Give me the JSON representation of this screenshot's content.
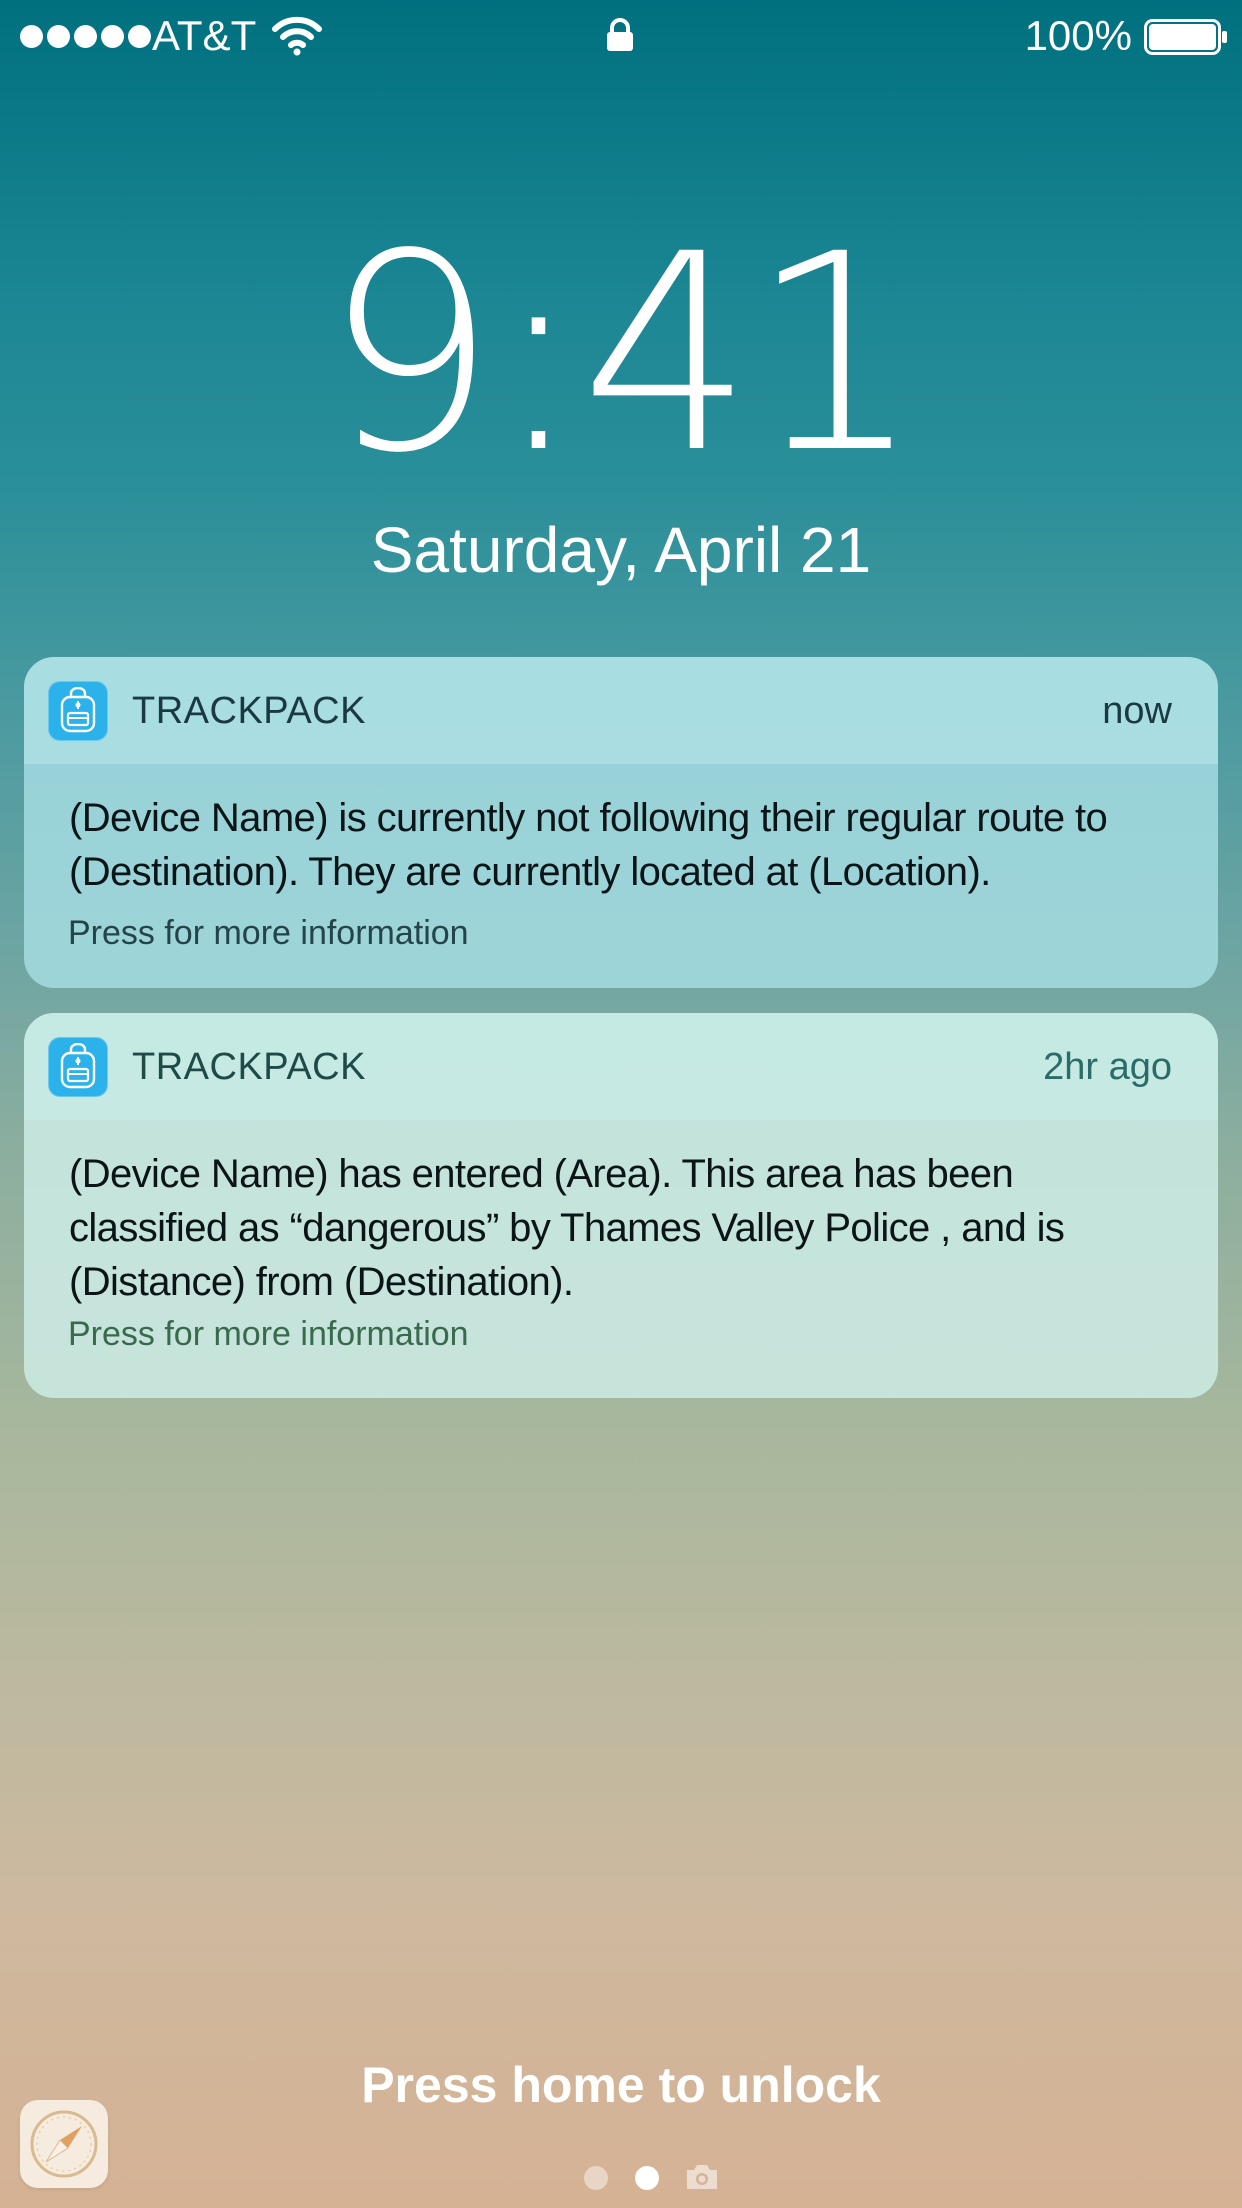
{
  "status_bar": {
    "carrier": "AT&T",
    "battery_percent": "100%",
    "signal_bars": 5,
    "battery_level": 1.0,
    "wifi_icon": "wifi-icon",
    "lock_icon": "lock-icon"
  },
  "lock_screen": {
    "time": "9:41",
    "date": "Saturday, April 21",
    "unlock_hint": "Press home to unlock"
  },
  "notifications": [
    {
      "app_name": "TRACKPACK",
      "time": "now",
      "body": "(Device Name) is currently not following their regular route to (Destination). They are currently located at (Location).",
      "more": "Press for more information",
      "icon": "backpack-icon"
    },
    {
      "app_name": "TRACKPACK",
      "time": "2hr ago",
      "body": "(Device Name) has entered (Area).  This area has been classified as “dangerous” by Thames Valley Police , and is (Distance) from (Destination).",
      "more": "Press for more information",
      "icon": "backpack-icon"
    }
  ],
  "bottom": {
    "shortcut_app_icon": "safari-icon",
    "camera_icon": "camera-icon",
    "page_count": 2,
    "current_page": 2
  },
  "colors": {
    "notification_text": "#0b1416",
    "app_icon_bg": "#2cb2ea",
    "top_gradient": "#00707f",
    "bottom_gradient": "#d6b294"
  }
}
